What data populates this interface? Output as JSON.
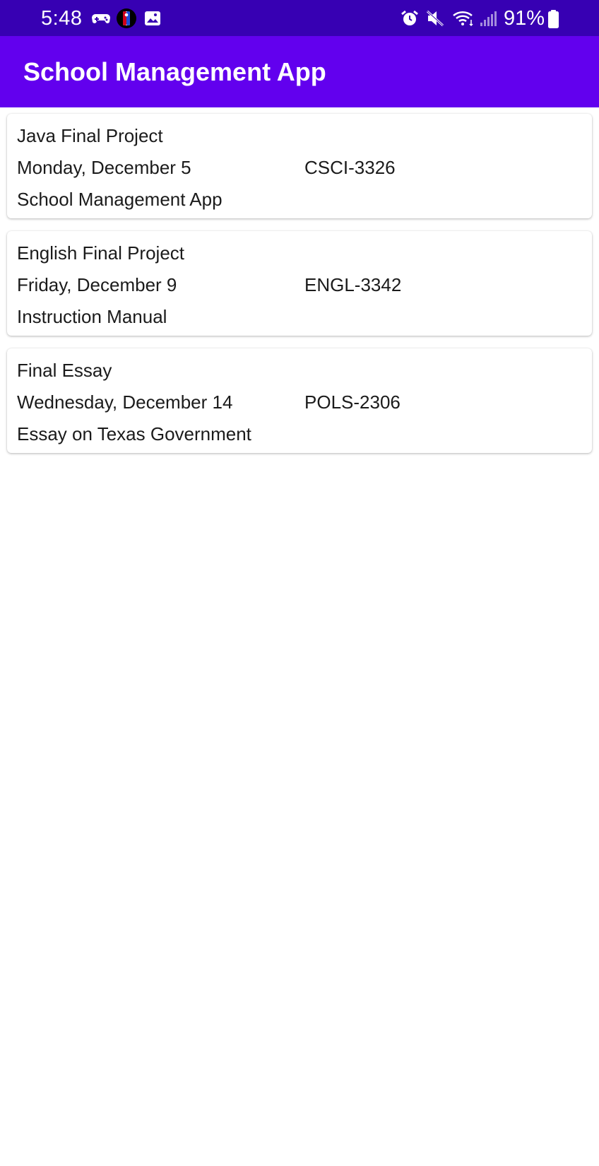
{
  "status_bar": {
    "time": "5:48",
    "battery": "91%",
    "left_icons": [
      "game-controller-icon",
      "nba-icon",
      "gallery-icon"
    ],
    "right_icons": [
      "alarm-icon",
      "mute-icon",
      "wifi-icon",
      "signal-icon",
      "battery-icon"
    ],
    "background_color": "#3700b3"
  },
  "app_bar": {
    "title": "School Management App",
    "background_color": "#6200ee"
  },
  "assignments": [
    {
      "title": "Java Final Project",
      "date": "Monday, December 5",
      "course": "CSCI-3326",
      "description": "School Management App"
    },
    {
      "title": "English Final Project",
      "date": "Friday, December 9",
      "course": "ENGL-3342",
      "description": "Instruction Manual"
    },
    {
      "title": "Final Essay",
      "date": "Wednesday, December 14",
      "course": "POLS-2306",
      "description": "Essay on Texas Government"
    }
  ]
}
